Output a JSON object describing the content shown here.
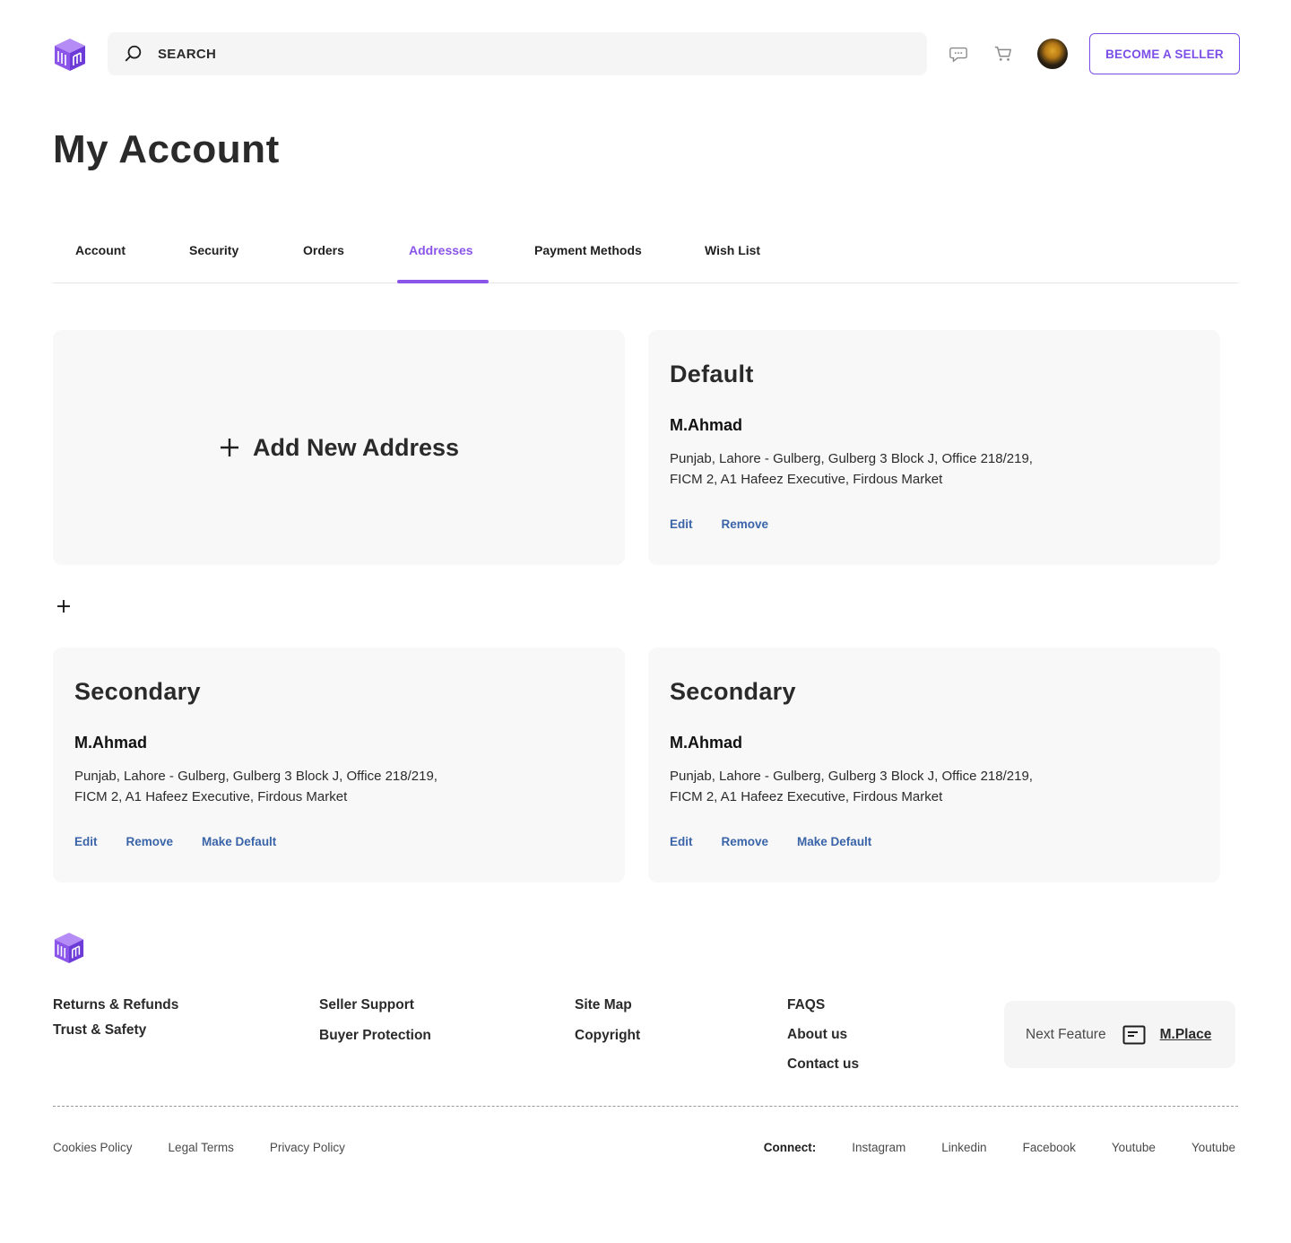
{
  "header": {
    "search_placeholder": "SEARCH",
    "seller_button": "BECOME A SELLER",
    "icons": [
      "logo-cube-icon",
      "search-icon",
      "chat-icon",
      "cart-icon",
      "avatar"
    ]
  },
  "page": {
    "title": "My Account"
  },
  "tabs": [
    {
      "label": "Account"
    },
    {
      "label": "Security"
    },
    {
      "label": "Orders"
    },
    {
      "label": "Addresses",
      "active": true
    },
    {
      "label": "Payment Methods"
    },
    {
      "label": "Wish List"
    }
  ],
  "add_card": {
    "label": "Add New Address"
  },
  "addresses": [
    {
      "type": "Default",
      "name": "M.Ahmad",
      "line1": "Punjab, Lahore - Gulberg, Gulberg 3 Block J, Office 218/219,",
      "line2": "FICM 2, A1 Hafeez Executive, Firdous Market",
      "actions": [
        "Edit",
        "Remove"
      ]
    },
    {
      "type": "Secondary",
      "name": "M.Ahmad",
      "line1": "Punjab, Lahore - Gulberg, Gulberg 3 Block J, Office 218/219,",
      "line2": "FICM 2, A1 Hafeez Executive, Firdous Market",
      "actions": [
        "Edit",
        "Remove",
        "Make Default"
      ]
    },
    {
      "type": "Secondary",
      "name": "M.Ahmad",
      "line1": "Punjab, Lahore - Gulberg, Gulberg 3 Block J, Office 218/219,",
      "line2": "FICM 2, A1 Hafeez Executive, Firdous Market",
      "actions": [
        "Edit",
        "Remove",
        "Make Default"
      ]
    }
  ],
  "footer": {
    "col1": [
      "Returns & Refunds",
      "Trust & Safety"
    ],
    "col2": [
      "Seller Support",
      "Buyer Protection"
    ],
    "col3": [
      "Site Map",
      "Copyright"
    ],
    "col4": [
      "FAQS",
      "About us",
      "Contact us"
    ],
    "next_feature": {
      "label": "Next Feature",
      "link": "M.Place"
    },
    "legal": [
      "Cookies Policy",
      "Legal Terms",
      "Privacy Policy"
    ],
    "connect_label": "Connect:",
    "social": [
      "Instagram",
      "Linkedin",
      "Facebook",
      "Youtube",
      "Youtube"
    ]
  },
  "colors": {
    "accent": "#8b55e9",
    "action_link": "#3a64a8",
    "card_bg": "#f8f8f8"
  }
}
